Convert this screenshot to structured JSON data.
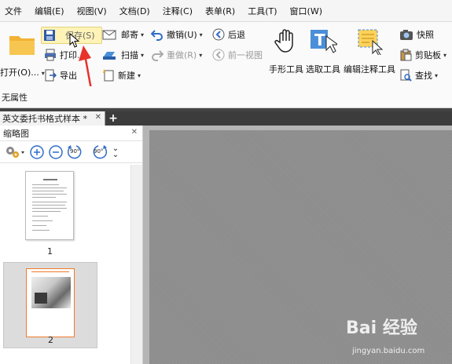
{
  "menu": [
    "文件",
    "编辑(E)",
    "视图(V)",
    "文档(D)",
    "注释(C)",
    "表单(R)",
    "工具(T)",
    "窗口(W)"
  ],
  "ribbon": {
    "open": "打开(O)...",
    "save": "保存(S)",
    "print": "打印",
    "export": "导出",
    "mail": "邮寄",
    "scan": "扫描",
    "new": "新建",
    "undo": "撤销(U)",
    "redo": "重做(R)",
    "back": "后退",
    "prev_view": "前一视图",
    "hand_tool": "手形工具",
    "select_tool": "选取工具",
    "edit_annot_tool": "编辑注释工具",
    "snapshot": "快照",
    "clipboard": "剪贴板",
    "find": "查找"
  },
  "properties_label": "无属性",
  "doc_tab": "英文委托书格式样本 *",
  "thumbnail_panel": {
    "title": "缩略图",
    "pages": [
      "1",
      "2"
    ],
    "rotate_left": "90°",
    "rotate_right": "90°"
  },
  "watermark": {
    "text": "Bai 经验",
    "sub": "jingyan.baidu.com"
  },
  "colors": {
    "accent_red": "#e8332a",
    "selection_orange": "#f07a2a",
    "canvas": "#8d8d8d"
  }
}
